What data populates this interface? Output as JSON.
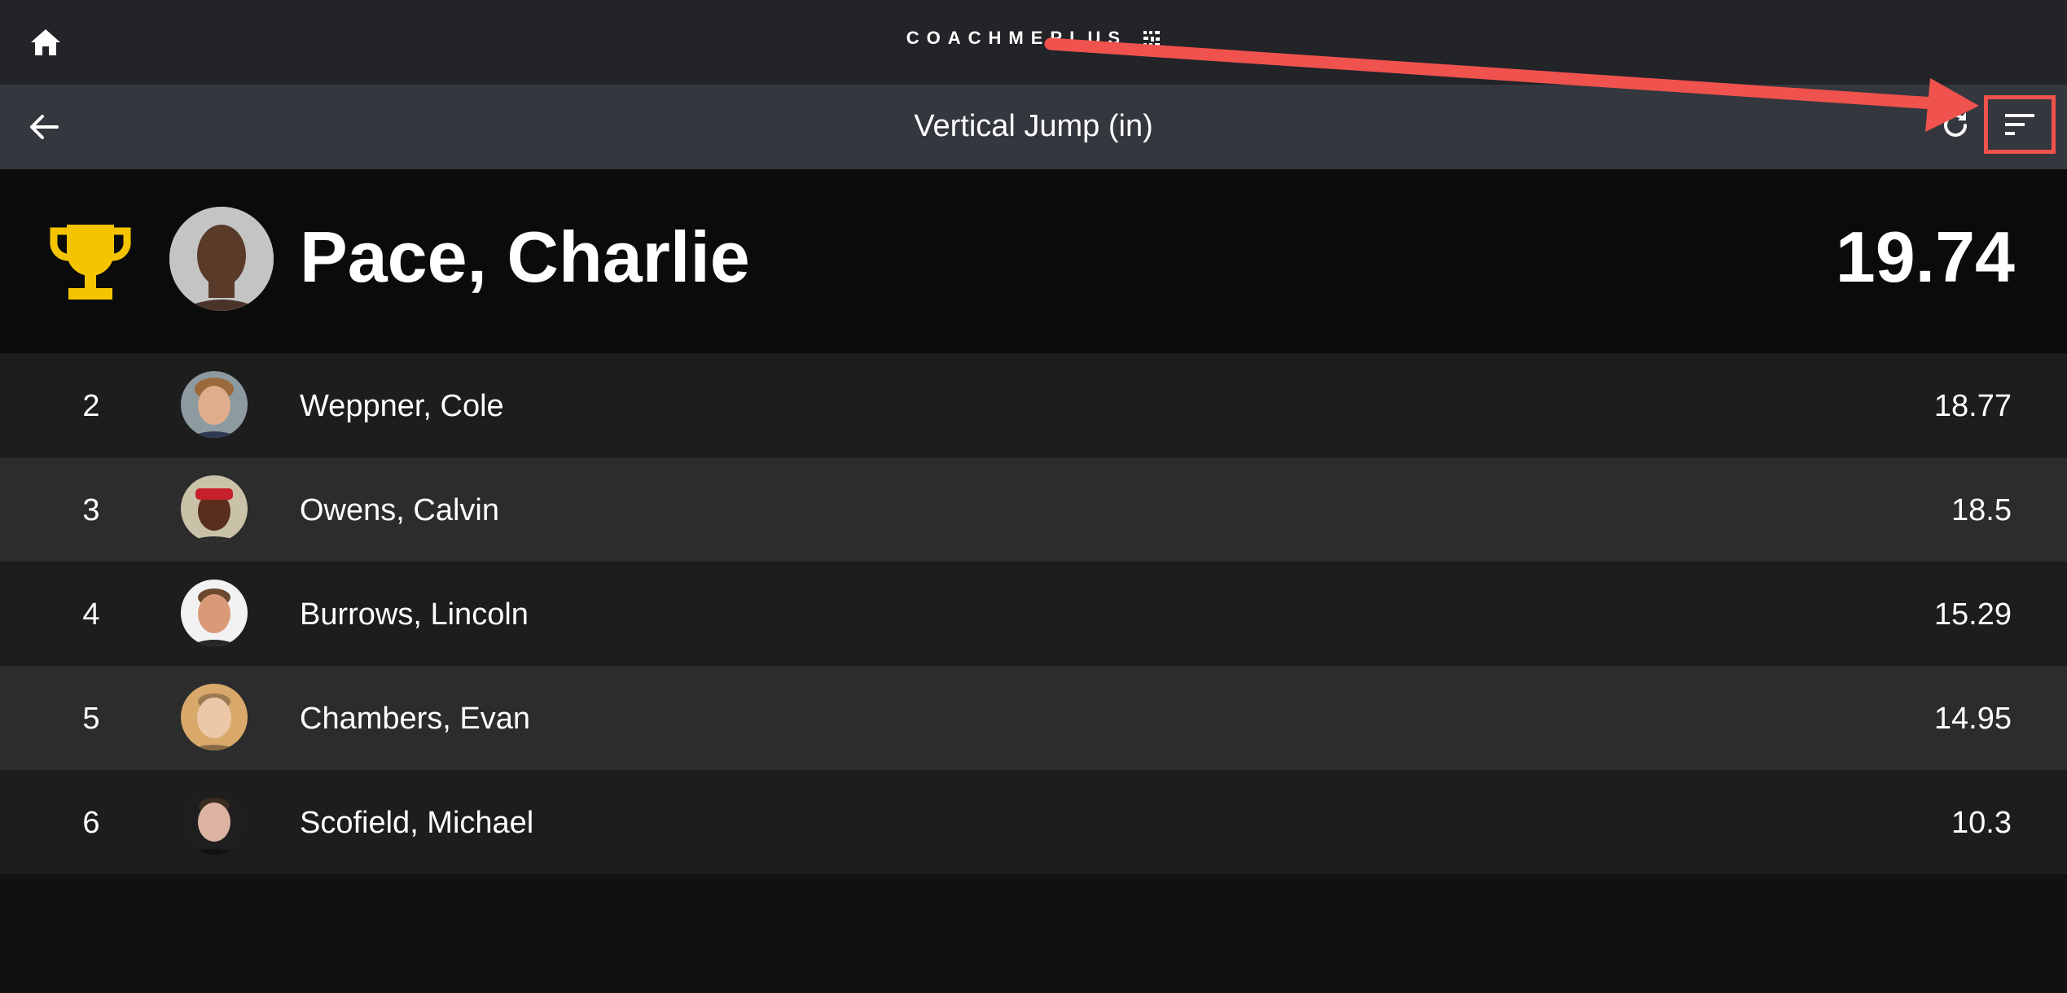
{
  "header": {
    "brand": "COACHMEPLUS",
    "title": "Vertical Jump (in)"
  },
  "leader": {
    "rank_icon": "trophy-icon",
    "name": "Pace, Charlie",
    "score": "19.74"
  },
  "rows": [
    {
      "rank": "2",
      "name": "Weppner, Cole",
      "score": "18.77"
    },
    {
      "rank": "3",
      "name": "Owens, Calvin",
      "score": "18.5"
    },
    {
      "rank": "4",
      "name": "Burrows, Lincoln",
      "score": "15.29"
    },
    {
      "rank": "5",
      "name": "Chambers, Evan",
      "score": "14.95"
    },
    {
      "rank": "6",
      "name": "Scofield, Michael",
      "score": "10.3"
    }
  ],
  "colors": {
    "accent_trophy": "#f5c400",
    "annotation": "#f0524e",
    "topbar": "#222428",
    "titlebar": "#34373d"
  }
}
